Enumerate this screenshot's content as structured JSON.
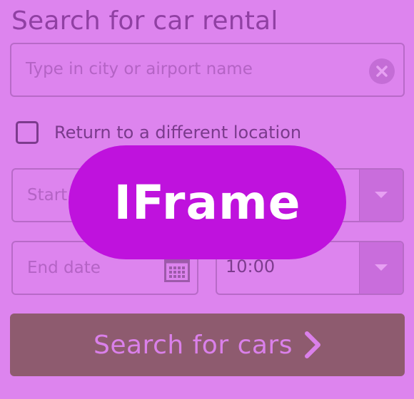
{
  "form": {
    "title": "Search for car rental",
    "location": {
      "placeholder": "Type in city or airport name"
    },
    "return_different": {
      "label": "Return to a different location",
      "checked": false
    },
    "start_date": {
      "placeholder": "Start date"
    },
    "start_time": {
      "value": ""
    },
    "end_date": {
      "placeholder": "End date"
    },
    "end_time": {
      "value": "10:00"
    },
    "search_button": {
      "label": "Search for cars"
    }
  },
  "overlay": {
    "label": "IFrame"
  },
  "icons": {
    "clear": "close-circle-icon",
    "calendar": "calendar-icon",
    "dropdown": "chevron-down-icon",
    "submit": "chevron-right-icon"
  },
  "colors": {
    "background": "#dd84ee",
    "border": "#b86ac8",
    "text": "#9040a3",
    "button": "#8e5b6f",
    "button_text": "#da80ea",
    "overlay": "#bf12dd"
  }
}
